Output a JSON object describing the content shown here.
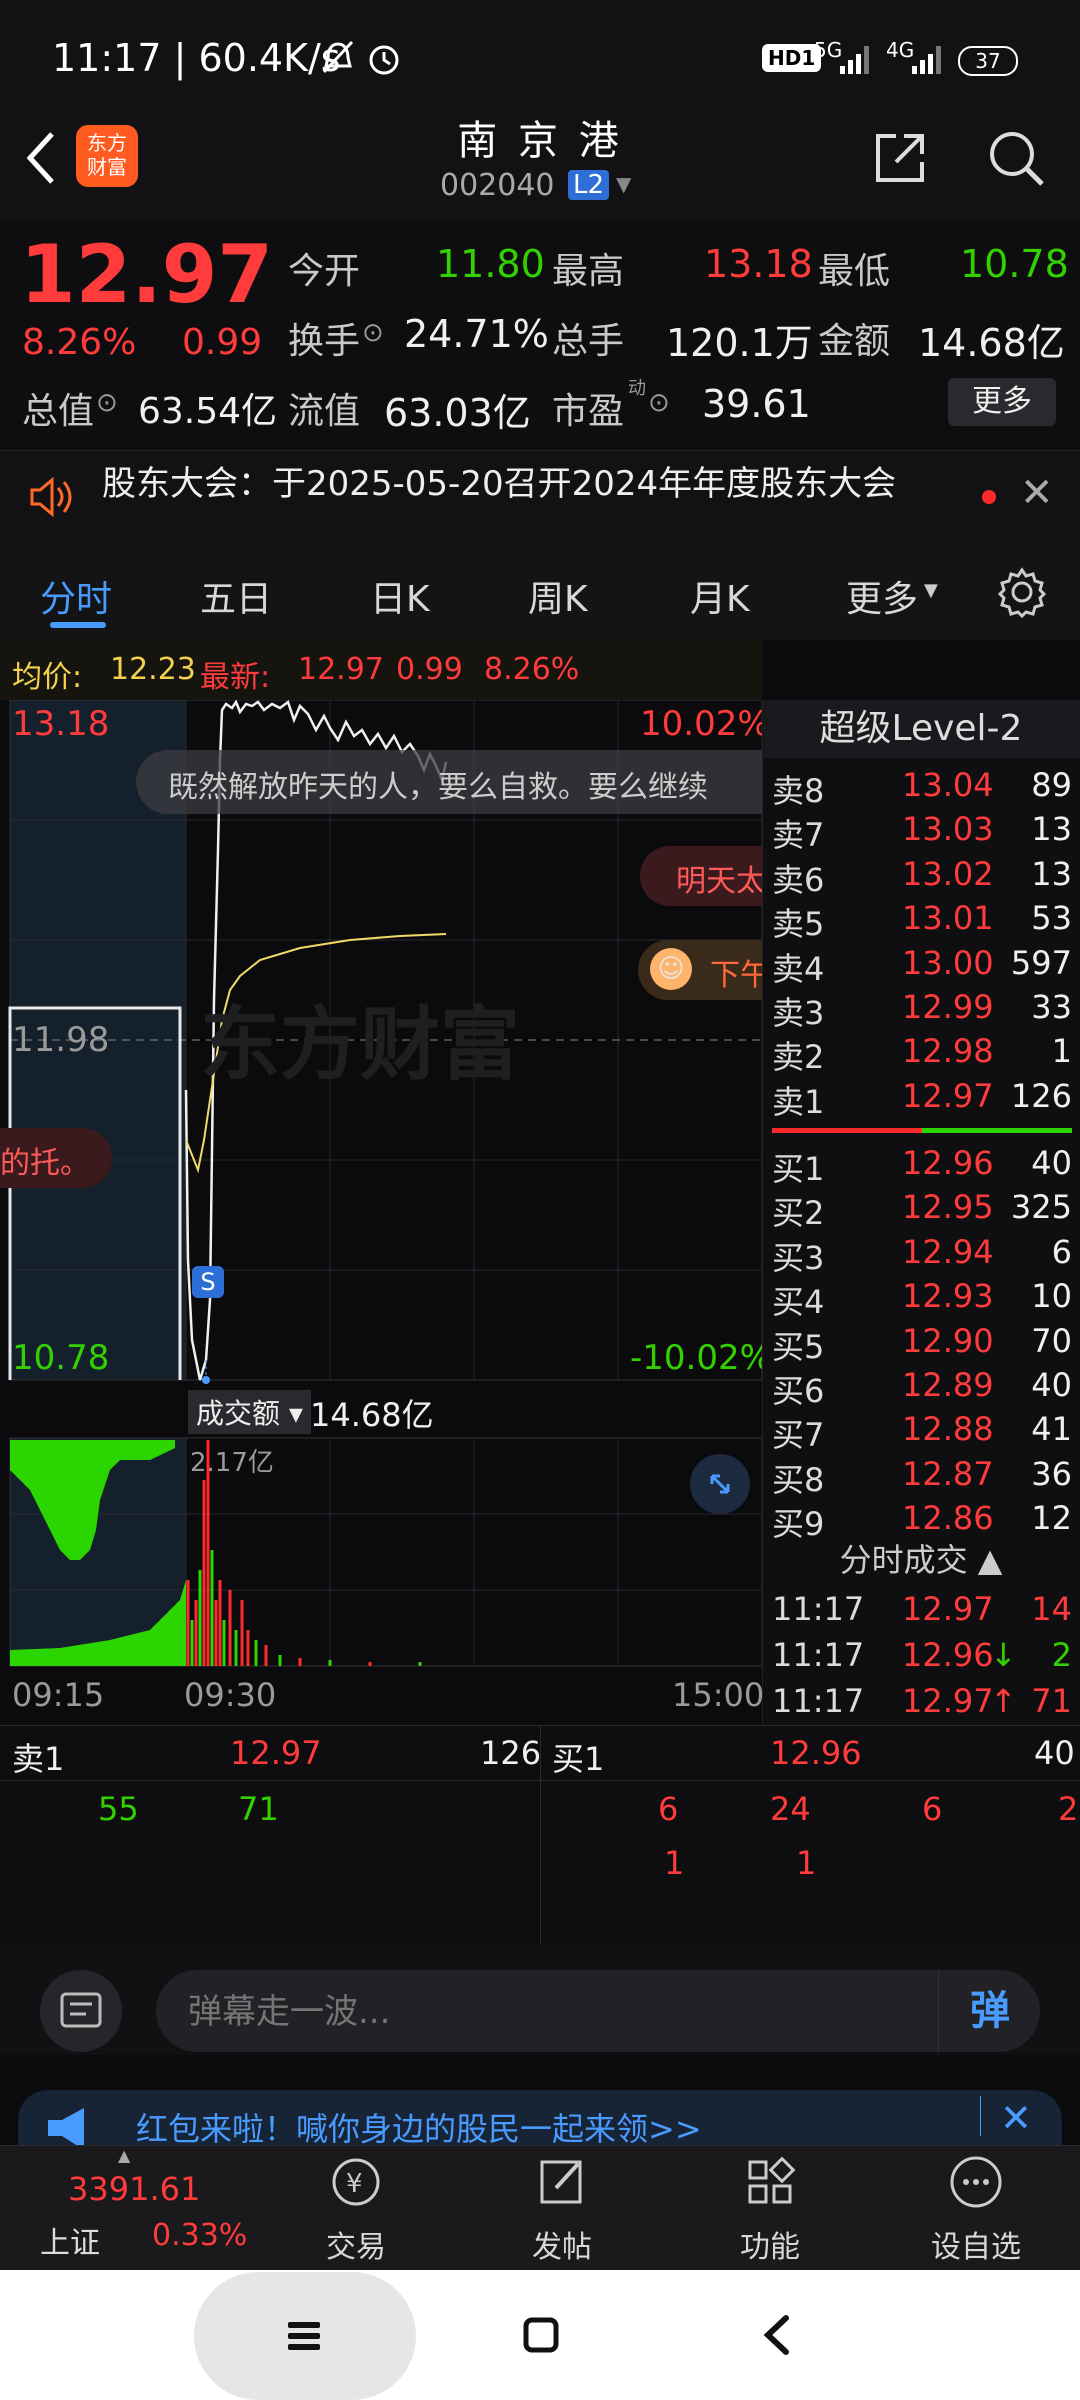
{
  "status": {
    "time": "11:17 | 60.4K/s",
    "net1": "HD1",
    "net2": "5G",
    "net3": "4G",
    "battery": "37"
  },
  "header": {
    "logo_line1": "东方",
    "logo_line2": "财富",
    "name": "南 京 港",
    "code": "002040",
    "level_badge": "L2"
  },
  "quote": {
    "price": "12.97",
    "change_pct": "8.26%",
    "change": "0.99",
    "open_label": "今开",
    "open": "11.80",
    "high_label": "最高",
    "high": "13.18",
    "low_label": "最低",
    "low": "10.78",
    "turnover_label": "换手",
    "turnover": "24.71%",
    "volume_label": "总手",
    "volume": "120.1万",
    "amount_label": "金额",
    "amount": "14.68亿",
    "mktcap_label": "总值",
    "mktcap": "63.54亿",
    "float_label": "流值",
    "float": "63.03亿",
    "pe_label": "市盈",
    "pe_sup": "动",
    "pe": "39.61",
    "more_button": "更多"
  },
  "notice": {
    "text": "股东大会：于2025-05-20召开2024年年度股东大会"
  },
  "tabs": [
    {
      "label": "分时"
    },
    {
      "label": "五日"
    },
    {
      "label": "日K"
    },
    {
      "label": "周K"
    },
    {
      "label": "月K"
    },
    {
      "label": "更多"
    }
  ],
  "chart": {
    "avg_label": "均价:",
    "avg": "12.23",
    "last_label": "最新:",
    "last": "12.97",
    "last_change": "0.99",
    "last_pct": "8.26%",
    "y_top": "13.18",
    "y_mid": "11.98",
    "y_bottom": "10.78",
    "pct_top": "10.02%",
    "pct_bottom": "-10.02%",
    "danmu1": "既然解放昨天的人，要么自救。要么继续",
    "danmu2": "明天太",
    "danmu3": "下午",
    "danmu4": "的托。",
    "watermark": "东方财富",
    "dollar": "S",
    "vol_label": "成交额",
    "vol_value": "14.68亿",
    "vol_max": "2.17亿",
    "time_start": "09:15",
    "time_open": "09:30",
    "time_end": "15:00"
  },
  "level2": {
    "title": "超级Level-2",
    "asks": [
      {
        "name": "卖8",
        "price": "13.04",
        "vol": "89"
      },
      {
        "name": "卖7",
        "price": "13.03",
        "vol": "13"
      },
      {
        "name": "卖6",
        "price": "13.02",
        "vol": "13"
      },
      {
        "name": "卖5",
        "price": "13.01",
        "vol": "53"
      },
      {
        "name": "卖4",
        "price": "13.00",
        "vol": "597"
      },
      {
        "name": "卖3",
        "price": "12.99",
        "vol": "33"
      },
      {
        "name": "卖2",
        "price": "12.98",
        "vol": "1"
      },
      {
        "name": "卖1",
        "price": "12.97",
        "vol": "126"
      }
    ],
    "bids": [
      {
        "name": "买1",
        "price": "12.96",
        "vol": "40"
      },
      {
        "name": "买2",
        "price": "12.95",
        "vol": "325"
      },
      {
        "name": "买3",
        "price": "12.94",
        "vol": "6"
      },
      {
        "name": "买4",
        "price": "12.93",
        "vol": "10"
      },
      {
        "name": "买5",
        "price": "12.90",
        "vol": "70"
      },
      {
        "name": "买6",
        "price": "12.89",
        "vol": "40"
      },
      {
        "name": "买7",
        "price": "12.88",
        "vol": "41"
      },
      {
        "name": "买8",
        "price": "12.87",
        "vol": "36"
      },
      {
        "name": "买9",
        "price": "12.86",
        "vol": "12"
      }
    ],
    "ticks_title": "分时成交",
    "ticks": [
      {
        "time": "11:17",
        "price": "12.97",
        "arrow": "",
        "vol": "14"
      },
      {
        "time": "11:17",
        "price": "12.96",
        "arrow": "↓",
        "vol": "2"
      },
      {
        "time": "11:17",
        "price": "12.97",
        "arrow": "↑",
        "vol": "71"
      }
    ]
  },
  "bottom_panel": {
    "sell_label": "卖1",
    "sell_price": "12.97",
    "sell_vol": "126",
    "buy_label": "买1",
    "buy_price": "12.96",
    "buy_vol": "40",
    "sell_q1": "55",
    "sell_q2": "71",
    "buy_q1": "6",
    "buy_q2": "24",
    "buy_q3": "6",
    "buy_q4": "2",
    "buy_q5": "1",
    "buy_q6": "1"
  },
  "comment": {
    "placeholder": "弹幕走一波...",
    "danmu_btn": "弹"
  },
  "promo": {
    "text": "红包来啦！喊你身边的股民一起来领>>"
  },
  "bottom_nav": {
    "index_value": "3391.61",
    "index_name": "上证",
    "index_pct": "0.33%",
    "items": [
      {
        "label": "交易"
      },
      {
        "label": "发帖"
      },
      {
        "label": "功能"
      },
      {
        "label": "设自选"
      }
    ]
  }
}
